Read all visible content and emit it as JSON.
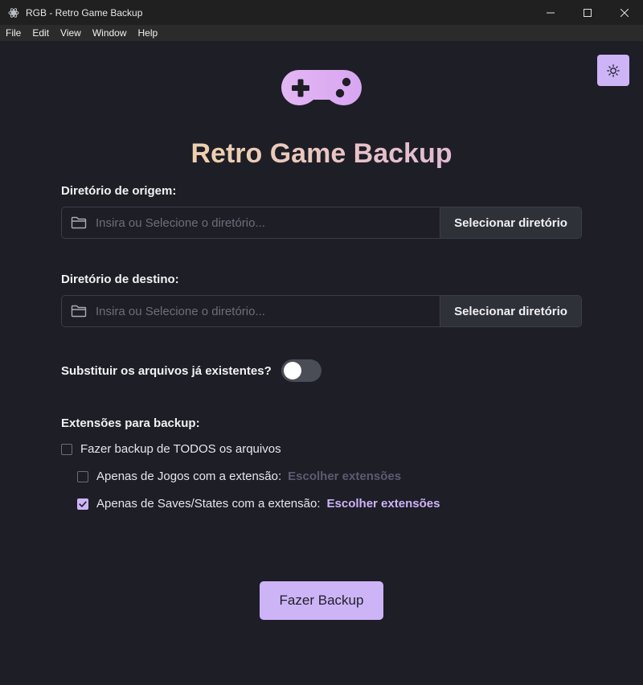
{
  "window": {
    "title": "RGB - Retro Game Backup",
    "minimize_glyph": "—",
    "maximize_glyph": "☐",
    "close_glyph": "✕"
  },
  "menu": [
    "File",
    "Edit",
    "View",
    "Window",
    "Help"
  ],
  "header": {
    "app_title": "Retro Game Backup",
    "logo_icon": "gamepad-icon",
    "theme_icon": "sun-icon"
  },
  "source": {
    "label": "Diretório de origem:",
    "placeholder": "Insira ou Selecione o diretório...",
    "value": "",
    "button_label": "Selecionar diretório"
  },
  "destination": {
    "label": "Diretório de destino:",
    "placeholder": "Insira ou Selecione o diretório...",
    "value": "",
    "button_label": "Selecionar diretório"
  },
  "overwrite": {
    "label": "Substituir os arquivos já existentes?",
    "enabled": false
  },
  "extensions": {
    "label": "Extensões para backup:",
    "all_files": {
      "label": "Fazer backup de TODOS os arquivos",
      "checked": false
    },
    "games": {
      "label": "Apenas de Jogos com a extensão:",
      "link": "Escolher extensões",
      "checked": false
    },
    "saves": {
      "label": "Apenas de Saves/States com a extensão:",
      "link": "Escolher extensões",
      "checked": true
    }
  },
  "backup_button": "Fazer Backup",
  "colors": {
    "accent": "#cdb4f7",
    "background": "#1e1e26",
    "title_gradient_start": "#f6e08a",
    "title_gradient_end": "#d4a9f2"
  }
}
